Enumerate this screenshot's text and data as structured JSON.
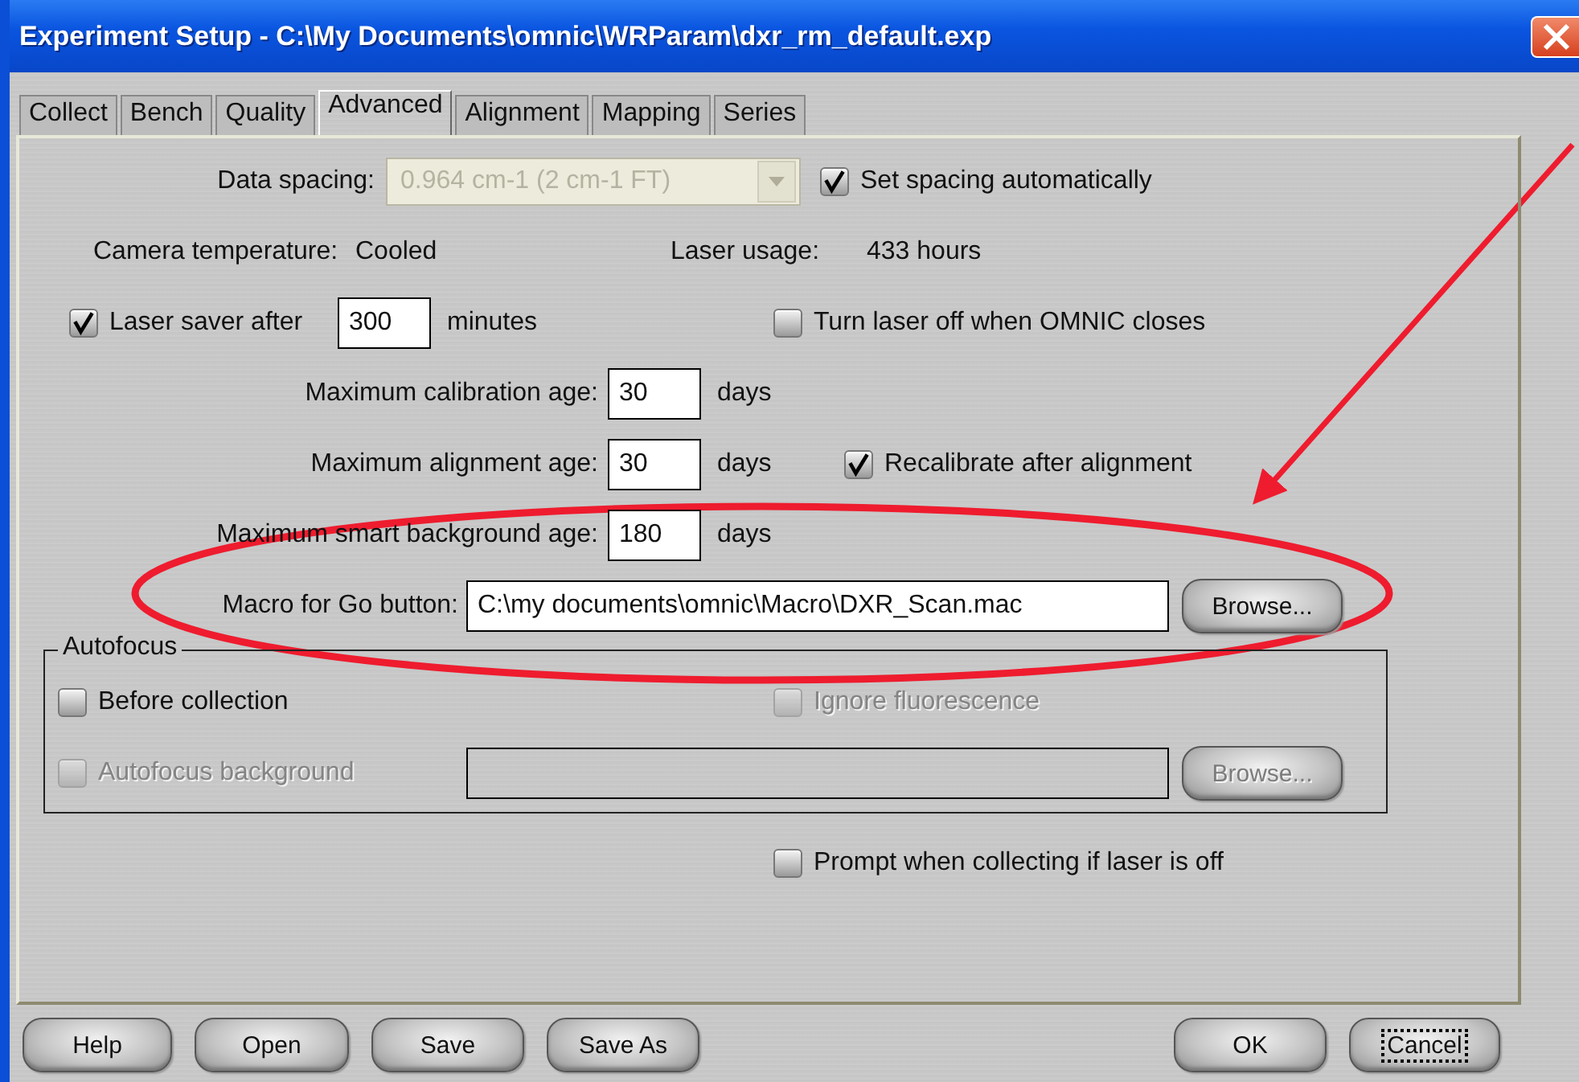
{
  "window": {
    "title": "Experiment Setup - C:\\My Documents\\omnic\\WRParam\\dxr_rm_default.exp"
  },
  "tabs": [
    {
      "label": "Collect",
      "selected": false
    },
    {
      "label": "Bench",
      "selected": false
    },
    {
      "label": "Quality",
      "selected": false
    },
    {
      "label": "Advanced",
      "selected": true
    },
    {
      "label": "Alignment",
      "selected": false
    },
    {
      "label": "Mapping",
      "selected": false
    },
    {
      "label": "Series",
      "selected": false
    }
  ],
  "data_spacing": {
    "label": "Data spacing:",
    "value": "0.964 cm-1 (2 cm-1 FT)",
    "disabled": true
  },
  "set_spacing": {
    "label": "Set spacing automatically",
    "checked": true
  },
  "camera_temperature": {
    "label": "Camera temperature:",
    "value": "Cooled"
  },
  "laser_usage": {
    "label": "Laser usage:",
    "value": "433 hours"
  },
  "laser_saver": {
    "label": "Laser saver after",
    "checked": true,
    "value": "300",
    "unit": "minutes"
  },
  "turn_laser_off": {
    "label": "Turn laser off when OMNIC closes",
    "checked": false
  },
  "ages": [
    {
      "label": "Maximum calibration age:",
      "value": "30",
      "unit": "days"
    },
    {
      "label": "Maximum alignment age:",
      "value": "30",
      "unit": "days"
    },
    {
      "label": "Maximum smart background age:",
      "value": "180",
      "unit": "days"
    }
  ],
  "recalibrate": {
    "label": "Recalibrate after alignment",
    "checked": true
  },
  "macro": {
    "label": "Macro for Go button:",
    "value": "C:\\my documents\\omnic\\Macro\\DXR_Scan.mac",
    "browse": "Browse..."
  },
  "autofocus": {
    "title": "Autofocus",
    "before_collection": {
      "label": "Before collection",
      "checked": false,
      "disabled": false
    },
    "ignore_fluorescence": {
      "label": "Ignore fluorescence",
      "checked": false,
      "disabled": true
    },
    "background": {
      "label": "Autofocus background",
      "checked": false,
      "disabled": true
    },
    "browse": {
      "label": "Browse...",
      "disabled": true
    }
  },
  "prompt": {
    "label": "Prompt when collecting if laser is off",
    "checked": false
  },
  "buttons": [
    {
      "label": "Help",
      "focused": false
    },
    {
      "label": "Open",
      "focused": false
    },
    {
      "label": "Save",
      "focused": false
    },
    {
      "label": "Save As",
      "focused": false
    },
    {
      "label": "OK",
      "focused": false
    },
    {
      "label": "Cancel",
      "focused": true
    }
  ],
  "markup": {
    "arrow": true,
    "ellipse": true
  }
}
